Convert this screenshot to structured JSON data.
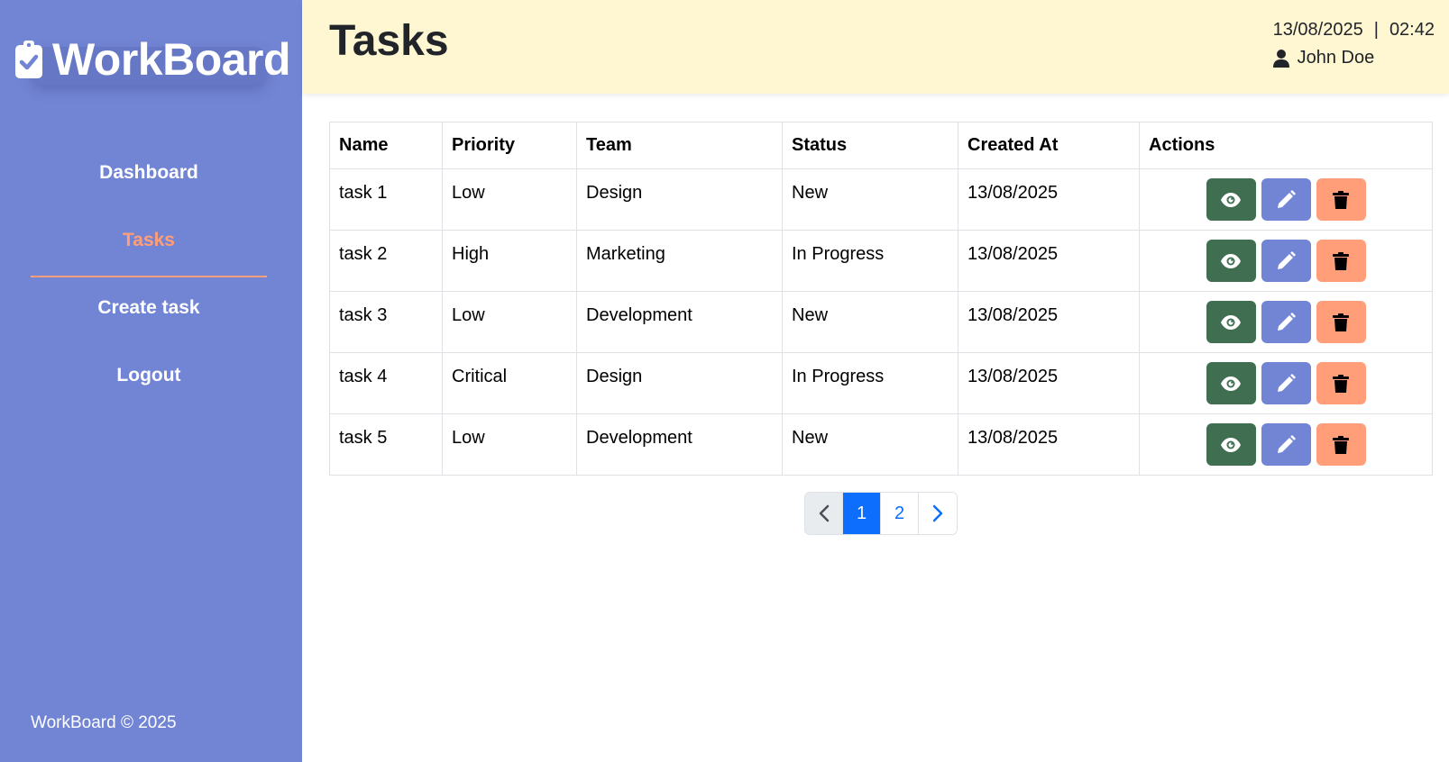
{
  "app": {
    "name": "WorkBoard",
    "footer": "WorkBoard © 2025"
  },
  "colors": {
    "sidebar": "#7285d4",
    "header": "#fff6d2",
    "accent": "#ff9e78",
    "view_button": "#3f6e50",
    "edit_button": "#7285d4",
    "delete_button": "#ff9e78",
    "pagination_active": "#0d6efd"
  },
  "sidebar": {
    "items": [
      {
        "label": "Dashboard",
        "active": false
      },
      {
        "label": "Tasks",
        "active": true
      },
      {
        "label": "Create task",
        "active": false
      },
      {
        "label": "Logout",
        "active": false
      }
    ]
  },
  "header": {
    "title": "Tasks",
    "date": "13/08/2025",
    "separator": "|",
    "time": "02:42",
    "user_name": "John Doe",
    "user_icon": "user-icon"
  },
  "table": {
    "columns": [
      "Name",
      "Priority",
      "Team",
      "Status",
      "Created At",
      "Actions"
    ],
    "rows": [
      {
        "name": "task 1",
        "priority": "Low",
        "team": "Design",
        "status": "New",
        "created_at": "13/08/2025"
      },
      {
        "name": "task 2",
        "priority": "High",
        "team": "Marketing",
        "status": "In Progress",
        "created_at": "13/08/2025"
      },
      {
        "name": "task 3",
        "priority": "Low",
        "team": "Development",
        "status": "New",
        "created_at": "13/08/2025"
      },
      {
        "name": "task 4",
        "priority": "Critical",
        "team": "Design",
        "status": "In Progress",
        "created_at": "13/08/2025"
      },
      {
        "name": "task 5",
        "priority": "Low",
        "team": "Development",
        "status": "New",
        "created_at": "13/08/2025"
      }
    ],
    "action_icons": [
      "eye-icon",
      "pencil-icon",
      "trash-icon"
    ]
  },
  "pagination": {
    "prev_icon": "chevron-left-icon",
    "pages": [
      "1",
      "2"
    ],
    "current_page": "1",
    "next_icon": "chevron-right-icon"
  }
}
